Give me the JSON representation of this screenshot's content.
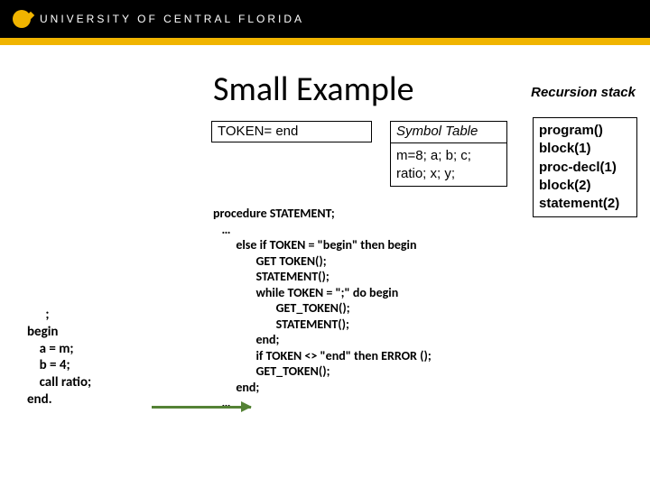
{
  "header": {
    "institution": "UNIVERSITY OF CENTRAL FLORIDA"
  },
  "title": "Small Example",
  "recursion_stack_title": "Recursion stack",
  "token_box": "TOKEN= end",
  "symbol_table": {
    "header": "Symbol Table",
    "body": "m=8; a; b; c; ratio; x; y;"
  },
  "stack": {
    "line1": "program()",
    "line2": "block(1)",
    "line3": "proc-decl(1)",
    "line4": "block(2)",
    "line5": "statement(2)"
  },
  "snippet": "      ;\nbegin\n    a = m;\n    b = 4;\n    call ratio;\nend.",
  "code": "procedure STATEMENT;\n   …\n        else if TOKEN = \"begin\" then begin\n               GET TOKEN();\n               STATEMENT();\n               while TOKEN = \";\" do begin\n                      GET_TOKEN();\n                      STATEMENT();\n               end;\n               if TOKEN <> \"end\" then ERROR ();\n               GET_TOKEN();\n        end;\n   …"
}
